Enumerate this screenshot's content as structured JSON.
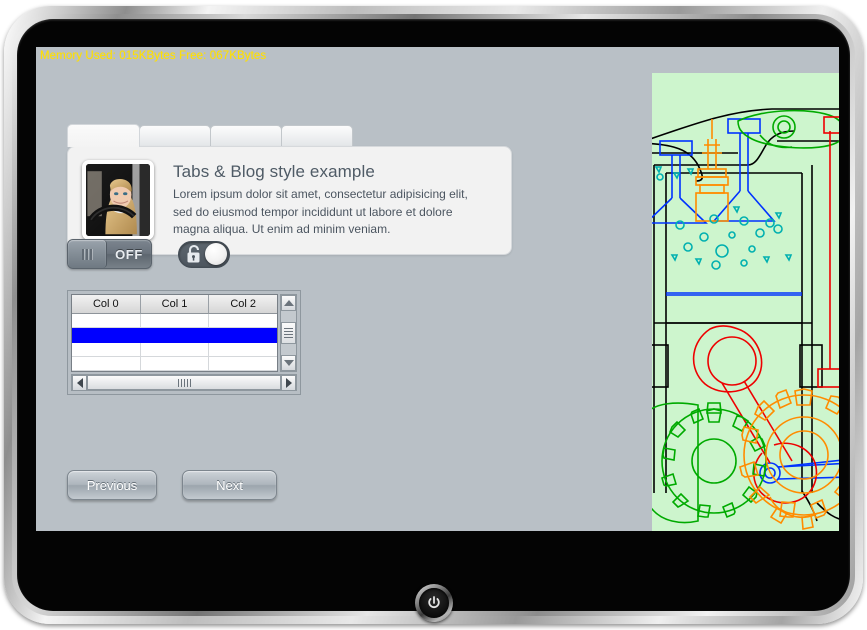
{
  "device": {
    "power_button_name": "power-button",
    "power_glyph": "⏻"
  },
  "screen": {
    "background_color": "#b9c0c6",
    "status_bar": {
      "text": "Memory Used: 015KBytes Free: 067KBytes",
      "color": "#ffe000"
    },
    "tabs": [
      {
        "label": "",
        "active": true
      },
      {
        "label": "",
        "active": false
      },
      {
        "label": "",
        "active": false
      },
      {
        "label": "",
        "active": false
      }
    ],
    "blog_panel": {
      "thumbnail_alt": "portrait-photo-woman-in-car",
      "title": "Tabs & Blog style example",
      "body": "Lorem ipsum dolor sit amet, consectetur adipisicing elit, sed do eiusmod tempor incididunt ut labore et dolore magna aliqua. Ut enim ad minim veniam."
    },
    "toggles": {
      "switch": {
        "state_label": "OFF",
        "handle_position": "left"
      },
      "lock": {
        "icon": "open-padlock",
        "knob_position": "right"
      }
    },
    "table": {
      "columns": [
        "Col 0",
        "Col 1",
        "Col 2"
      ],
      "rows": [
        {
          "cells": [
            "",
            "",
            ""
          ],
          "selected": false
        },
        {
          "cells": [
            "",
            "",
            ""
          ],
          "selected": true
        },
        {
          "cells": [
            "",
            "",
            ""
          ],
          "selected": false
        },
        {
          "cells": [
            "",
            "",
            ""
          ],
          "selected": false
        }
      ],
      "selection_color": "#0000ff",
      "vertical_scrollbar": {
        "up_icon": "triangle-up",
        "down_icon": "triangle-down"
      },
      "horizontal_scrollbar": {
        "left_icon": "triangle-left",
        "right_icon": "triangle-right"
      }
    },
    "navigation": {
      "previous_label": "Previous",
      "next_label": "Next"
    },
    "illustration": {
      "title": "engine-cylinder-technical-diagram",
      "background_color": "#cdf5cd",
      "colors": {
        "valve": "#0033ff",
        "spark_plug": "#ff8c00",
        "rocker_arm": "#00aa00",
        "gear_green": "#00aa00",
        "gear_orange": "#ff8c00",
        "conrod": "#ee0000",
        "outline": "#000000",
        "particles": "#00b0b0"
      }
    }
  }
}
